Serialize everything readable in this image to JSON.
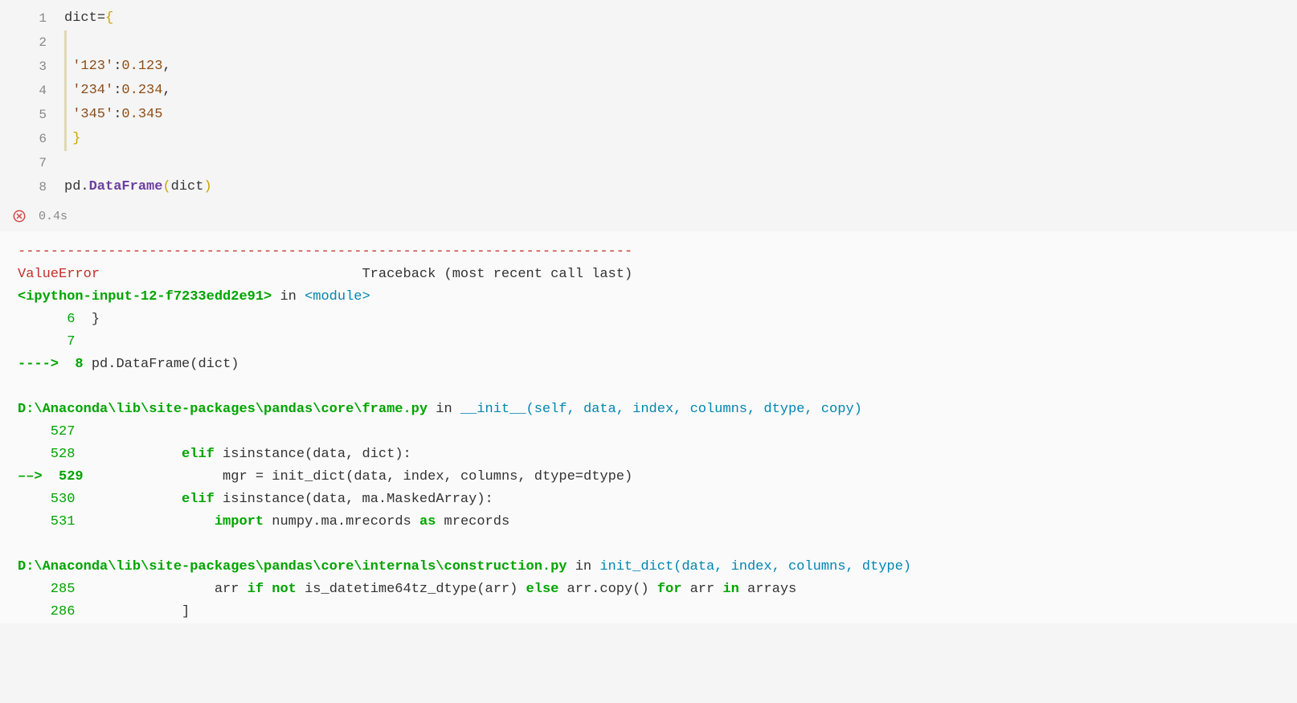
{
  "code": {
    "lines": [
      {
        "num": "1",
        "indent": false,
        "tokens": [
          {
            "t": "dict",
            "c": "tok-var"
          },
          {
            "t": "=",
            "c": "tok-op"
          },
          {
            "t": "{",
            "c": "tok-brace-y"
          }
        ]
      },
      {
        "num": "2",
        "indent": true,
        "tokens": []
      },
      {
        "num": "3",
        "indent": true,
        "tokens": [
          {
            "t": "'123'",
            "c": "tok-str"
          },
          {
            "t": ":",
            "c": "tok-op"
          },
          {
            "t": "0.123",
            "c": "tok-num"
          },
          {
            "t": ",",
            "c": "tok-op"
          }
        ]
      },
      {
        "num": "4",
        "indent": true,
        "tokens": [
          {
            "t": "'234'",
            "c": "tok-str"
          },
          {
            "t": ":",
            "c": "tok-op"
          },
          {
            "t": "0.234",
            "c": "tok-num"
          },
          {
            "t": ",",
            "c": "tok-op"
          }
        ]
      },
      {
        "num": "5",
        "indent": true,
        "tokens": [
          {
            "t": "'345'",
            "c": "tok-str"
          },
          {
            "t": ":",
            "c": "tok-op"
          },
          {
            "t": "0.345",
            "c": "tok-num"
          }
        ]
      },
      {
        "num": "6",
        "indent": true,
        "tokens": [
          {
            "t": "}",
            "c": "tok-brace-y"
          }
        ]
      },
      {
        "num": "7",
        "indent": false,
        "tokens": []
      },
      {
        "num": "8",
        "indent": false,
        "tokens": [
          {
            "t": "pd",
            "c": "tok-var"
          },
          {
            "t": ".",
            "c": "tok-op"
          },
          {
            "t": "DataFrame",
            "c": "tok-attr"
          },
          {
            "t": "(",
            "c": "tok-paren-y"
          },
          {
            "t": "dict",
            "c": "tok-var"
          },
          {
            "t": ")",
            "c": "tok-paren-y"
          }
        ]
      }
    ]
  },
  "status": {
    "duration": "0.4s"
  },
  "traceback": {
    "separator": "---------------------------------------------------------------------------",
    "error_name": "ValueError",
    "header_suffix": "                                Traceback (most recent call last)",
    "frames": [
      {
        "loc": "<ipython-input-12-f7233edd2e91>",
        "in": " in ",
        "fn": "<module>",
        "sig": "",
        "lines": [
          {
            "num": "      6 ",
            "arrow": "",
            "code_parts": [
              {
                "t": " }",
                "c": "ansi-default"
              }
            ]
          },
          {
            "num": "      7 ",
            "arrow": "",
            "code_parts": []
          },
          {
            "num": " 8 ",
            "arrow": "----> ",
            "code_parts": [
              {
                "t": "pd",
                "c": "ansi-default"
              },
              {
                "t": ".",
                "c": "ansi-default"
              },
              {
                "t": "DataFrame",
                "c": "ansi-default"
              },
              {
                "t": "(",
                "c": "ansi-default"
              },
              {
                "t": "dict",
                "c": "ansi-default"
              },
              {
                "t": ")",
                "c": "ansi-default"
              }
            ]
          }
        ]
      },
      {
        "loc": "D:\\Anaconda\\lib\\site-packages\\pandas\\core\\frame.py",
        "in": " in ",
        "fn": "__init__",
        "sig": "(self, data, index, columns, dtype, copy)",
        "lines": [
          {
            "num": "    527 ",
            "arrow": "",
            "code_parts": []
          },
          {
            "num": "    528 ",
            "arrow": "",
            "code_parts": [
              {
                "t": "            ",
                "c": "ansi-default"
              },
              {
                "t": "elif",
                "c": "ansi-green bold"
              },
              {
                "t": " isinstance",
                "c": "ansi-default"
              },
              {
                "t": "(",
                "c": "ansi-default"
              },
              {
                "t": "data",
                "c": "ansi-default"
              },
              {
                "t": ",",
                "c": "ansi-default"
              },
              {
                "t": " dict",
                "c": "ansi-default"
              },
              {
                "t": ")",
                "c": "ansi-default"
              },
              {
                "t": ":",
                "c": "ansi-default"
              }
            ]
          },
          {
            "num": " 529 ",
            "arrow": "––> ",
            "code_parts": [
              {
                "t": "                mgr ",
                "c": "ansi-default"
              },
              {
                "t": "=",
                "c": "ansi-default"
              },
              {
                "t": " init_dict",
                "c": "ansi-default"
              },
              {
                "t": "(",
                "c": "ansi-default"
              },
              {
                "t": "data",
                "c": "ansi-default"
              },
              {
                "t": ",",
                "c": "ansi-default"
              },
              {
                "t": " index",
                "c": "ansi-default"
              },
              {
                "t": ",",
                "c": "ansi-default"
              },
              {
                "t": " columns",
                "c": "ansi-default"
              },
              {
                "t": ",",
                "c": "ansi-default"
              },
              {
                "t": " dtype",
                "c": "ansi-default"
              },
              {
                "t": "=",
                "c": "ansi-default"
              },
              {
                "t": "dtype",
                "c": "ansi-default"
              },
              {
                "t": ")",
                "c": "ansi-default"
              }
            ]
          },
          {
            "num": "    530 ",
            "arrow": "",
            "code_parts": [
              {
                "t": "            ",
                "c": "ansi-default"
              },
              {
                "t": "elif",
                "c": "ansi-green bold"
              },
              {
                "t": " isinstance",
                "c": "ansi-default"
              },
              {
                "t": "(",
                "c": "ansi-default"
              },
              {
                "t": "data",
                "c": "ansi-default"
              },
              {
                "t": ",",
                "c": "ansi-default"
              },
              {
                "t": " ma",
                "c": "ansi-default"
              },
              {
                "t": ".",
                "c": "ansi-default"
              },
              {
                "t": "MaskedArray",
                "c": "ansi-default"
              },
              {
                "t": ")",
                "c": "ansi-default"
              },
              {
                "t": ":",
                "c": "ansi-default"
              }
            ]
          },
          {
            "num": "    531 ",
            "arrow": "",
            "code_parts": [
              {
                "t": "                ",
                "c": "ansi-default"
              },
              {
                "t": "import",
                "c": "ansi-green bold"
              },
              {
                "t": " numpy",
                "c": "ansi-default"
              },
              {
                "t": ".",
                "c": "ansi-default"
              },
              {
                "t": "ma",
                "c": "ansi-default"
              },
              {
                "t": ".",
                "c": "ansi-default"
              },
              {
                "t": "mrecords ",
                "c": "ansi-default"
              },
              {
                "t": "as",
                "c": "ansi-green bold"
              },
              {
                "t": " mrecords",
                "c": "ansi-default"
              }
            ]
          }
        ]
      },
      {
        "loc": "D:\\Anaconda\\lib\\site-packages\\pandas\\core\\internals\\construction.py",
        "in": " in ",
        "fn": "init_dict",
        "sig": "(data, index, columns, dtype)",
        "lines": [
          {
            "num": "    285 ",
            "arrow": "",
            "code_parts": [
              {
                "t": "                arr ",
                "c": "ansi-default"
              },
              {
                "t": "if",
                "c": "ansi-green bold"
              },
              {
                "t": " ",
                "c": "ansi-default"
              },
              {
                "t": "not",
                "c": "ansi-green bold"
              },
              {
                "t": " is_datetime64tz_dtype",
                "c": "ansi-default"
              },
              {
                "t": "(",
                "c": "ansi-default"
              },
              {
                "t": "arr",
                "c": "ansi-default"
              },
              {
                "t": ")",
                "c": "ansi-default"
              },
              {
                "t": " ",
                "c": "ansi-default"
              },
              {
                "t": "else",
                "c": "ansi-green bold"
              },
              {
                "t": " arr",
                "c": "ansi-default"
              },
              {
                "t": ".",
                "c": "ansi-default"
              },
              {
                "t": "copy",
                "c": "ansi-default"
              },
              {
                "t": "()",
                "c": "ansi-default"
              },
              {
                "t": " ",
                "c": "ansi-default"
              },
              {
                "t": "for",
                "c": "ansi-green bold"
              },
              {
                "t": " arr ",
                "c": "ansi-default"
              },
              {
                "t": "in",
                "c": "ansi-green bold"
              },
              {
                "t": " arrays",
                "c": "ansi-default"
              }
            ]
          },
          {
            "num": "    286 ",
            "arrow": "",
            "code_parts": [
              {
                "t": "            ]",
                "c": "ansi-default"
              }
            ]
          }
        ]
      }
    ]
  }
}
